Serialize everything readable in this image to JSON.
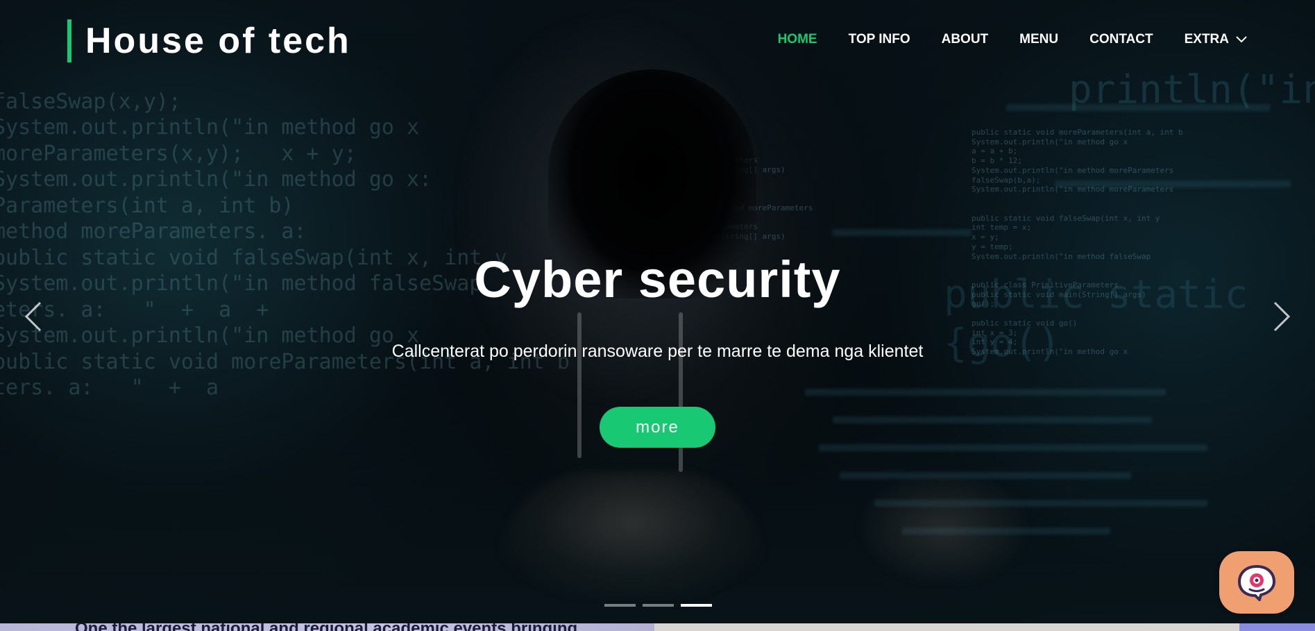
{
  "brand": {
    "name": "House of tech",
    "accent_color": "#19c873"
  },
  "nav": {
    "items": [
      {
        "label": "HOME",
        "active": true
      },
      {
        "label": "TOP INFO",
        "active": false
      },
      {
        "label": "ABOUT",
        "active": false
      },
      {
        "label": "MENU",
        "active": false
      },
      {
        "label": "CONTACT",
        "active": false
      },
      {
        "label": "EXTRA",
        "active": false,
        "icon": "chevron-down-icon"
      }
    ]
  },
  "hero": {
    "title": "Cyber security",
    "subtitle": "Callcenterat po perdorin ransoware per te marre te dema nga klientet",
    "button_label": "more",
    "prev_icon": "chevron-left-icon",
    "next_icon": "chevron-right-icon",
    "slide_count": 3,
    "active_slide": 3
  },
  "chat": {
    "icon": "chat-bubble-icon",
    "color": "#f0a070"
  },
  "next_section": {
    "teaser": "One the largest national and regional academic events bringing"
  },
  "backdrop_code": [
    "System.out.println(\"in method go x",
    "falseSwap(x,y);",
    "moreParameters(x,y);   x + y;",
    "System.out.println(\"in method go x:",
    "public static void falseSwap(int x, int y",
    "method moreParameters. a:",
    "System.out.println(\"in method falseSwap",
    "public static void moreParameters(int a, int b",
    "public class PrimitiveParameters",
    "public static void main(String[] args)",
    "System.out.println(\"in method moreParameters",
    "public static void go()"
  ]
}
